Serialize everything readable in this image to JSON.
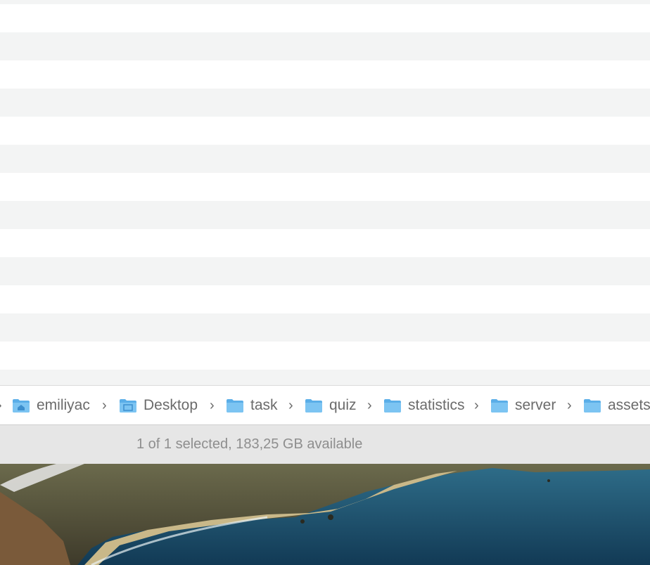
{
  "path_bar": {
    "items": [
      {
        "label": "emiliyac",
        "icon": "home-folder-icon"
      },
      {
        "label": "Desktop",
        "icon": "desktop-folder-icon"
      },
      {
        "label": "task",
        "icon": "folder-icon"
      },
      {
        "label": "quiz",
        "icon": "folder-icon"
      },
      {
        "label": "statistics",
        "icon": "folder-icon"
      },
      {
        "label": "server",
        "icon": "folder-icon"
      },
      {
        "label": "assets",
        "icon": "folder-icon"
      }
    ],
    "separator": "›"
  },
  "status_bar": {
    "text": "1 of 1 selected, 183,25 GB available"
  },
  "colors": {
    "row_alt": "#f3f4f4",
    "folder_blue": "#6cb8ec",
    "status_bg": "#e6e6e6"
  },
  "desktop": {
    "wallpaper": "coastal-cliffs-wallpaper"
  }
}
